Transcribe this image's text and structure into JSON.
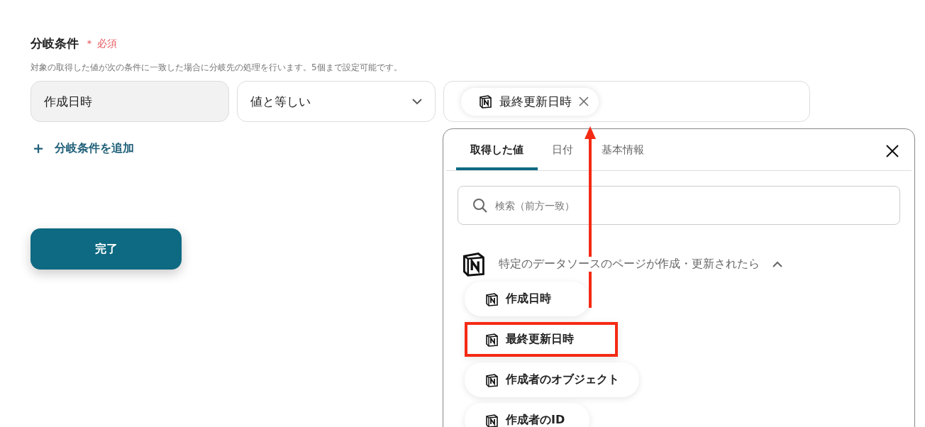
{
  "field": {
    "label": "分岐条件",
    "required_mark": "＊",
    "required_text": "必須",
    "description": "対象の取得した値が次の条件に一致した場合に分岐先の処理を行います。5個まで設定可能です。"
  },
  "condition": {
    "target": "作成日時",
    "operator": "値と等しい",
    "value_chip": "最終更新日時"
  },
  "add_link": {
    "icon": "＋",
    "label": "分岐条件を追加"
  },
  "done_button": "完了",
  "popover": {
    "tabs": [
      {
        "label": "取得した値",
        "selected": true
      },
      {
        "label": "日付",
        "selected": false
      },
      {
        "label": "基本情報",
        "selected": false
      }
    ],
    "search": {
      "placeholder": "検索（前方一致）"
    },
    "group": {
      "title": "特定のデータソースのページが作成・更新されたら",
      "expanded": true,
      "items": [
        {
          "label": "作成日時",
          "highlighted": false
        },
        {
          "label": "最終更新日時",
          "highlighted": true
        },
        {
          "label": "作成者のオブジェクト",
          "highlighted": false
        },
        {
          "label": "作成者のID",
          "highlighted": false
        }
      ]
    }
  }
}
